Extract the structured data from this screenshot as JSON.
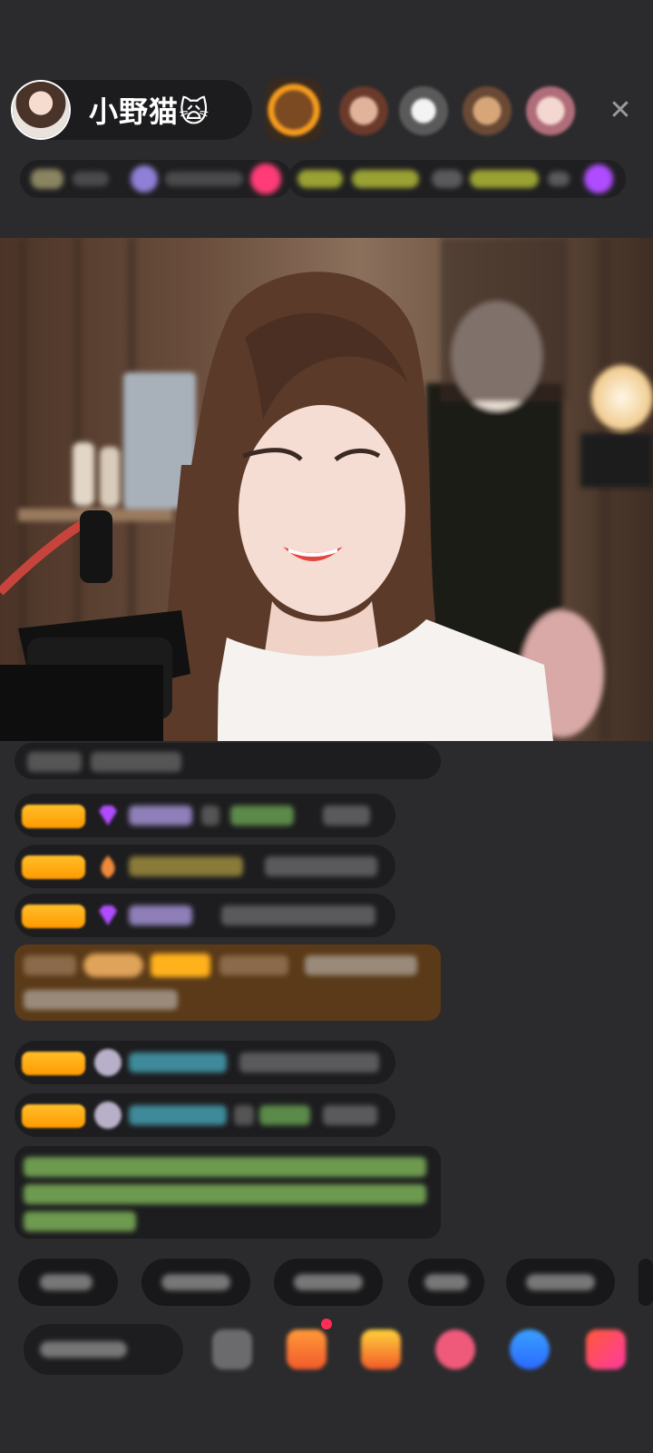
{
  "host": {
    "name": "小野猫🙀"
  },
  "header": {
    "viewer_avatar_count": 5,
    "close_icon": "close-icon"
  },
  "colors": {
    "background": "#2b2b2d",
    "level_badge": "#ffa800",
    "gem": "#b04cff",
    "highlight_row": "#5a3a18",
    "system_message_text": "#8ad16a"
  }
}
